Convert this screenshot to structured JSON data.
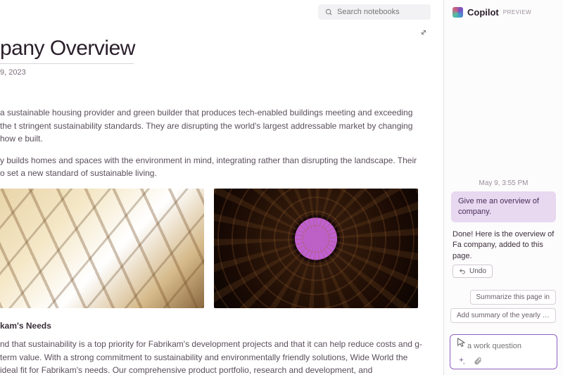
{
  "search": {
    "placeholder": "Search notebooks"
  },
  "document": {
    "title": "pany Overview",
    "date": "9, 2023",
    "paragraph1": "a sustainable housing provider and green builder that produces tech-enabled buildings meeting and exceeding the t stringent sustainability standards. They are disrupting the world's largest addressable market by changing how e built.",
    "paragraph2": "y builds homes and spaces with the environment in mind, integrating rather than disrupting the landscape. Their o set a new standard of sustainable living.",
    "subheading": "kam's Needs",
    "paragraph3": "nd that sustainability is a top priority for Fabrikam's development projects and that it can help reduce costs and g-term value. With a strong commitment to sustainability and environmentally friendly solutions, Wide World the ideal fit for Fabrikam's needs. Our comprehensive product portfolio, research and development, and"
  },
  "copilot": {
    "title": "Copilot",
    "badge": "PREVIEW",
    "timestamp": "May 9, 3:55 PM",
    "user_msg": "Give me an overview of company.",
    "assistant_msg": "Done! Here is the overview of Fa company, added to this page.",
    "undo_label": "Undo",
    "suggestions": [
      "Summarize this page in",
      "Add summary of the yearly financial"
    ],
    "composer_placeholder": "a work question"
  }
}
